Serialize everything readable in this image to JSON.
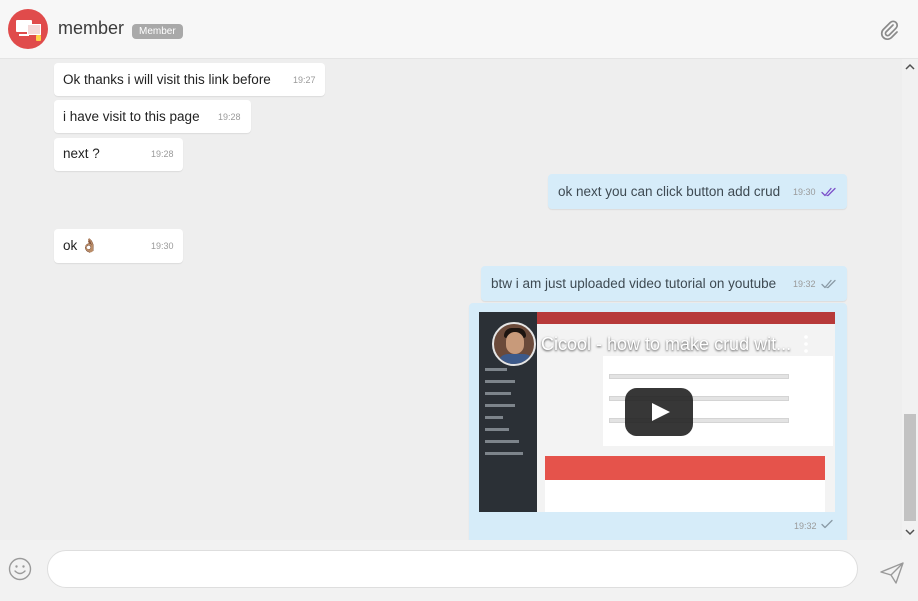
{
  "header": {
    "contact_name": "member",
    "role_badge": "Member",
    "attach_icon": "paperclip-icon"
  },
  "messages": [
    {
      "direction": "in",
      "text": "Ok thanks i will visit this link before",
      "time": "19:27"
    },
    {
      "direction": "in",
      "text": "i have visit to this page",
      "time": "19:28"
    },
    {
      "direction": "in",
      "text": "next ?",
      "time": "19:28"
    },
    {
      "direction": "out",
      "text": "ok next you can click button add crud",
      "time": "19:30",
      "status": "read"
    },
    {
      "direction": "in",
      "text": "ok 👌🏽",
      "time": "19:30"
    },
    {
      "direction": "out",
      "text": "btw i am just uploaded video tutorial on youtube",
      "time": "19:32",
      "status": "sent"
    },
    {
      "direction": "out",
      "type": "video",
      "video_title": "Cicool - how to make crud wit...",
      "time": "19:32",
      "status": "sent"
    }
  ],
  "composer": {
    "input_value": "",
    "input_placeholder": "",
    "emoji_icon": "smiley-icon",
    "send_icon": "paper-plane-icon"
  },
  "colors": {
    "incoming_bubble": "#ffffff",
    "outgoing_bubble": "#d6ecf9",
    "chat_background": "#eeeeee",
    "avatar": "#e04b4b",
    "read_tick": "#7b4fc9",
    "sent_tick": "#8a9aa5",
    "youtube_overlay": "#212121"
  }
}
